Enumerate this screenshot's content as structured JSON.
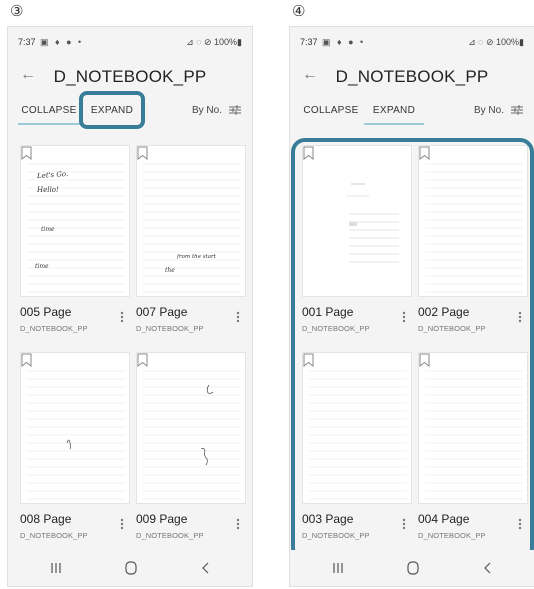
{
  "steps": [
    "③",
    "④"
  ],
  "status": {
    "time": "7:37",
    "left_icons": "▣ ♦ ● •",
    "right": "⊿ ◌ ⊘ 100%▮"
  },
  "header": {
    "title": "D_NOTEBOOK_PP",
    "back_icon": "arrow-left-icon"
  },
  "tabs": {
    "collapse": "COLLAPSE",
    "expand": "EXPAND"
  },
  "sort": {
    "label": "By No.",
    "icon": "sliders-icon"
  },
  "colors": {
    "highlight": "#3a7d98",
    "tab_underline": "#9ec9d6",
    "background": "#f4f4f4"
  },
  "screens": [
    {
      "active_tab": "COLLAPSE",
      "pages": [
        {
          "title": "005 Page",
          "notebook": "D_NOTEBOOK_PP",
          "handwriting": [
            "Let's Go.",
            "Hello!",
            "time",
            "time"
          ]
        },
        {
          "title": "007 Page",
          "notebook": "D_NOTEBOOK_PP",
          "handwriting": [
            "from the start",
            "the"
          ]
        },
        {
          "title": "008 Page",
          "notebook": "D_NOTEBOOK_PP",
          "handwriting": []
        },
        {
          "title": "009 Page",
          "notebook": "D_NOTEBOOK_PP",
          "handwriting": []
        }
      ]
    },
    {
      "active_tab": "EXPAND",
      "pages": [
        {
          "title": "001 Page",
          "notebook": "D_NOTEBOOK_PP",
          "handwriting": []
        },
        {
          "title": "002 Page",
          "notebook": "D_NOTEBOOK_PP",
          "handwriting": []
        },
        {
          "title": "003 Page",
          "notebook": "D_NOTEBOOK_PP",
          "handwriting": []
        },
        {
          "title": "004 Page",
          "notebook": "D_NOTEBOOK_PP",
          "handwriting": []
        }
      ]
    }
  ],
  "nav": {
    "recent": "recent-apps-icon",
    "home": "home-icon",
    "back": "back-icon"
  }
}
